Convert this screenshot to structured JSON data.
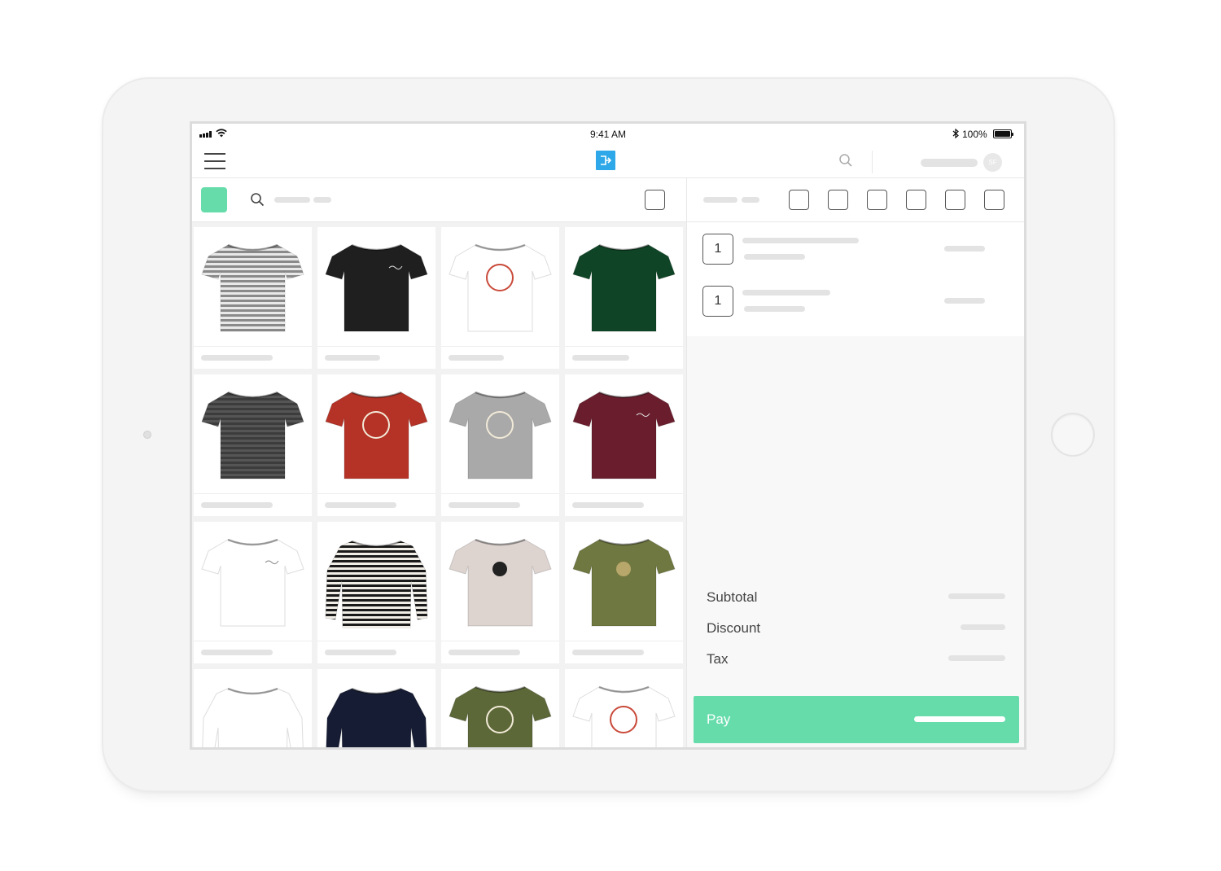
{
  "status_bar": {
    "time": "9:41 AM",
    "battery": "100%",
    "bluetooth_icon": "bluetooth-icon",
    "wifi_icon": "wifi-icon",
    "signal_icon": "cellular-signal-icon"
  },
  "header": {
    "menu_icon": "hamburger-menu-icon",
    "logo_icon": "pos-logo-icon",
    "search_icon": "search-icon",
    "avatar_initials": "SF"
  },
  "catalog": {
    "search_icon": "search-icon",
    "accent_color": "#66dcab",
    "products": [
      {
        "style": "stripe",
        "color": "#8a8a8a"
      },
      {
        "style": "plain",
        "color": "#1f1f1f"
      },
      {
        "style": "print",
        "color": "#ffffff"
      },
      {
        "style": "plain",
        "color": "#0f4526"
      },
      {
        "style": "stripe",
        "color": "#3c3c3c"
      },
      {
        "style": "print",
        "color": "#b53226"
      },
      {
        "style": "print",
        "color": "#a9a9a9"
      },
      {
        "style": "plain",
        "color": "#6a1e2d"
      },
      {
        "style": "plain",
        "color": "#ffffff"
      },
      {
        "style": "longsleeve-stripe",
        "color": "#1a1a1a"
      },
      {
        "style": "badge",
        "color": "#ddd3cf"
      },
      {
        "style": "badge",
        "color": "#6f7840"
      },
      {
        "style": "longsleeve",
        "color": "#ffffff"
      },
      {
        "style": "longsleeve",
        "color": "#161c33"
      },
      {
        "style": "print",
        "color": "#5c6838"
      },
      {
        "style": "print",
        "color": "#ffffff"
      }
    ]
  },
  "cart": {
    "line_items": [
      {
        "quantity": "1"
      },
      {
        "quantity": "1"
      }
    ],
    "subtotal_label": "Subtotal",
    "discount_label": "Discount",
    "tax_label": "Tax",
    "pay_label": "Pay",
    "pay_color": "#66dcab"
  }
}
